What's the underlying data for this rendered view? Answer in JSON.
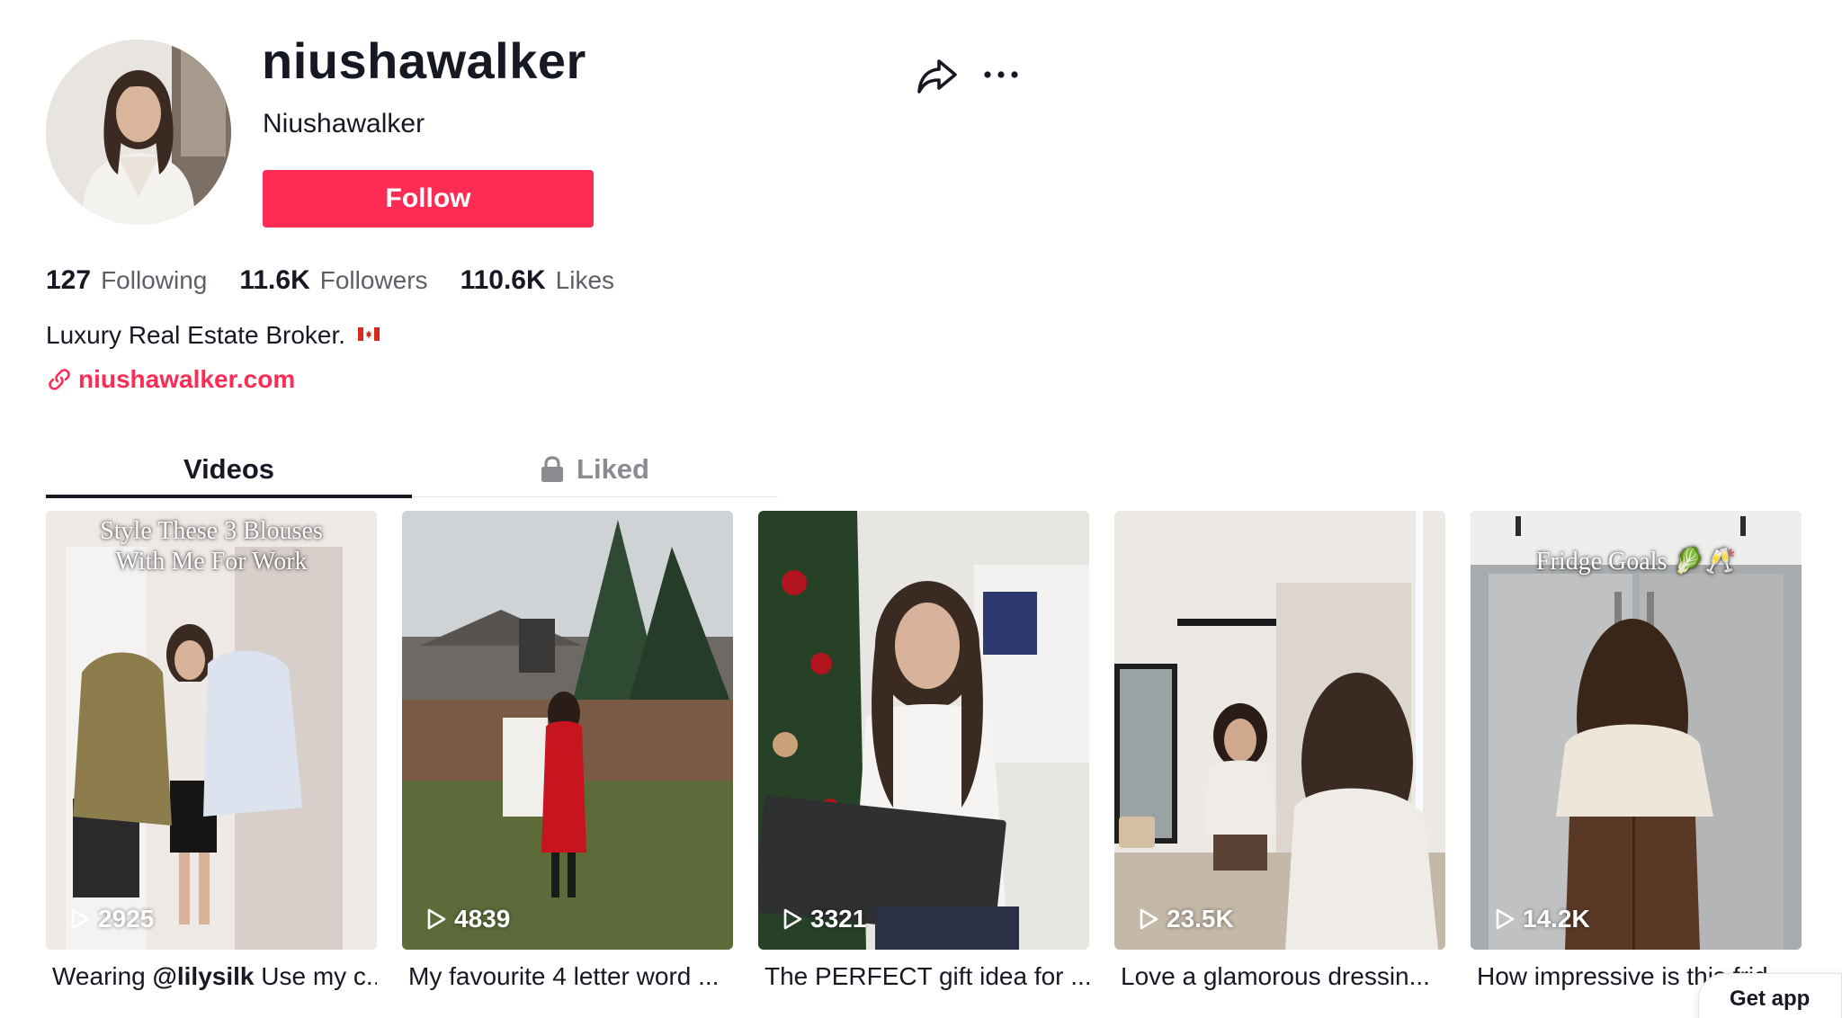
{
  "profile": {
    "username": "niushawalker",
    "nickname": "Niushawalker",
    "follow_label": "Follow",
    "bio": "Luxury Real Estate Broker.",
    "bio_flag": "canada-flag-icon",
    "link": "niushawalker.com"
  },
  "stats": {
    "following_count": "127",
    "following_label": "Following",
    "followers_count": "11.6K",
    "followers_label": "Followers",
    "likes_count": "110.6K",
    "likes_label": "Likes"
  },
  "tabs": {
    "videos": "Videos",
    "liked": "Liked"
  },
  "videos": [
    {
      "views": "2925",
      "caption_prefix": "Wearing ",
      "caption_mention": "@lilysilk",
      "caption_rest": " Use my c...",
      "overlay": [
        "Style These 3 Blouses",
        "With Me For Work"
      ]
    },
    {
      "views": "4839",
      "caption": "My favourite 4 letter word ..."
    },
    {
      "views": "3321",
      "caption": "The PERFECT gift idea for ..."
    },
    {
      "views": "23.5K",
      "caption": "Love a glamorous dressin..."
    },
    {
      "views": "14.2K",
      "caption": "How impressive is this frid...",
      "overlay": [
        "Fridge Goals 🥬🥂"
      ]
    }
  ],
  "get_app": "Get app",
  "colors": {
    "accent": "#fe2c55",
    "text_primary": "#161823",
    "text_secondary": "#5c5f66"
  }
}
